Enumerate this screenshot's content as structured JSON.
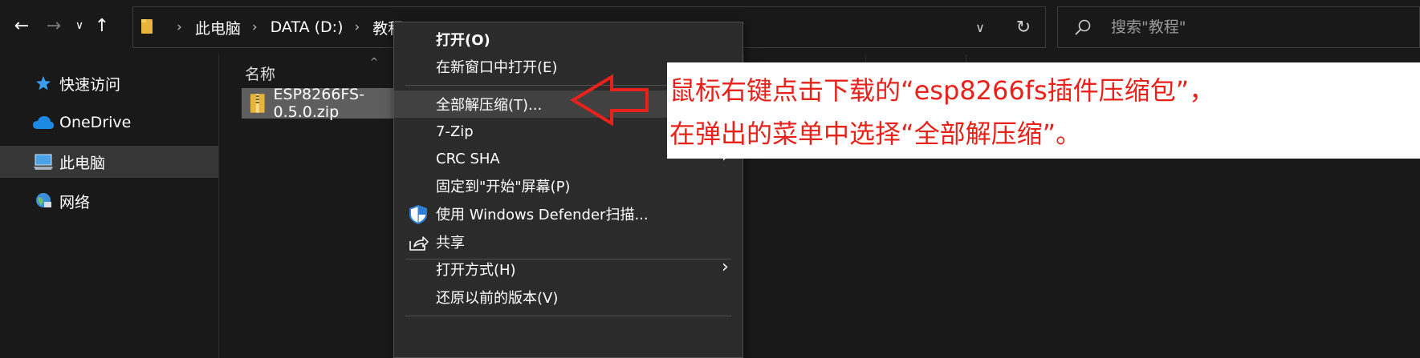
{
  "nav": {
    "back_icon": "arrow-left",
    "forward_icon": "arrow-right",
    "recent_icon": "chevron-down",
    "up_icon": "arrow-up"
  },
  "address_bar": {
    "breadcrumbs": [
      "此电脑",
      "DATA (D:)",
      "教程"
    ],
    "dropdown_icon": "chevron-down",
    "refresh_icon": "refresh"
  },
  "search": {
    "placeholder": "搜索\"教程\""
  },
  "sidebar": {
    "items": [
      {
        "label": "快速访问",
        "icon": "star-icon"
      },
      {
        "label": "OneDrive",
        "icon": "cloud-icon"
      },
      {
        "label": "此电脑",
        "icon": "computer-icon",
        "selected": true
      },
      {
        "label": "网络",
        "icon": "network-icon"
      }
    ]
  },
  "file_list": {
    "columns": [
      "名称"
    ],
    "files": [
      {
        "name": "ESP8266FS-0.5.0.zip",
        "icon": "zip-folder-icon",
        "selected": true
      }
    ]
  },
  "context_menu": {
    "items": [
      {
        "label": "打开(O)",
        "bold": true
      },
      {
        "label": "在新窗口中打开(E)"
      },
      {
        "label": "全部解压缩(T)...",
        "highlighted": true
      },
      {
        "label": "7-Zip",
        "submenu": true
      },
      {
        "label": "CRC SHA",
        "submenu": true
      },
      {
        "label": "固定到\"开始\"屏幕(P)"
      },
      {
        "label": "使用 Windows Defender扫描...",
        "icon": "defender-shield-icon"
      },
      {
        "label": "共享",
        "icon": "share-icon"
      },
      {
        "label": "打开方式(H)",
        "submenu": true
      },
      {
        "label": "还原以前的版本(V)"
      }
    ]
  },
  "annotation": {
    "line1": "鼠标右键点击下载的“esp8266fs插件压缩包”，",
    "line2": "在弹出的菜单中选择“全部解压缩”。",
    "color": "#e8221a"
  },
  "colors": {
    "background": "#191919",
    "menu_background": "#2b2b2b",
    "selection": "#5e5e5e",
    "annotation_red": "#e8221a"
  }
}
